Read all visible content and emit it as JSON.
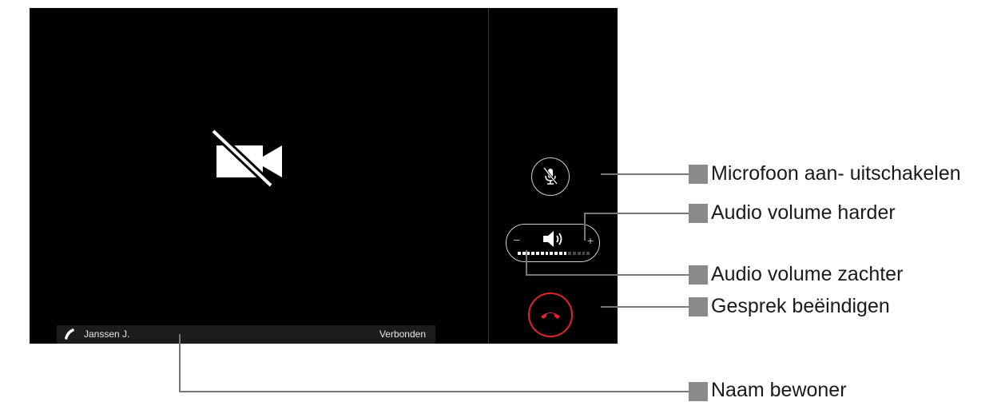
{
  "call": {
    "resident_name": "Janssen J.",
    "status": "Verbonden"
  },
  "controls": {
    "volume_minus": "–",
    "volume_plus": "+",
    "volume_level": 0.69,
    "volume_steps_on": 11,
    "volume_steps_total": 16,
    "hangup_color": "#e0262c"
  },
  "icons": {
    "video": "video-off-icon",
    "mic": "mic-off-icon",
    "speaker": "speaker-icon",
    "hangup": "phone-hangup-icon",
    "phone": "phone-icon"
  },
  "callouts": {
    "mic": "Microfoon aan- uitschakelen",
    "volume_up": "Audio volume harder",
    "volume_down": "Audio volume zachter",
    "hangup": "Gesprek beëindigen",
    "resident": "Naam bewoner"
  }
}
